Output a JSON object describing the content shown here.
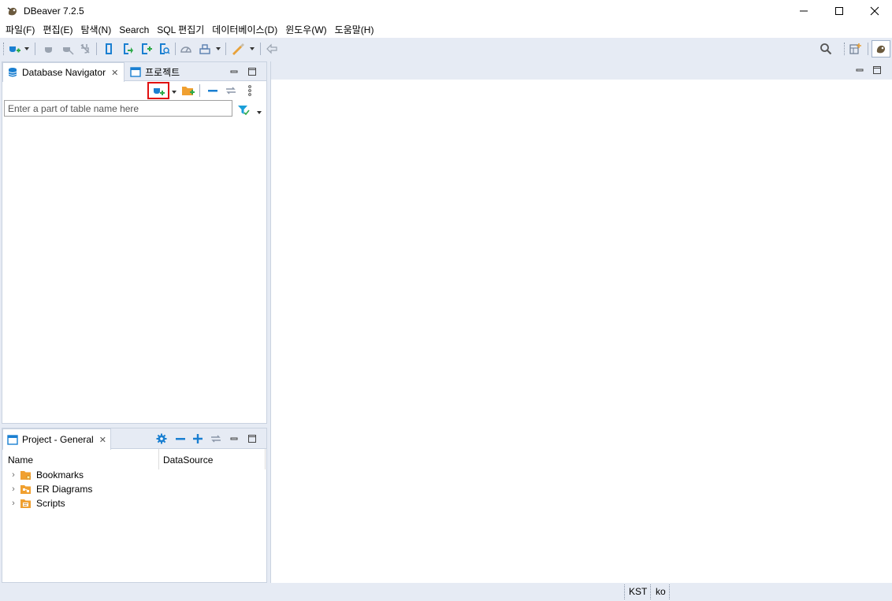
{
  "window": {
    "title": "DBeaver 7.2.5"
  },
  "menu": {
    "items": [
      "파일(F)",
      "편집(E)",
      "탐색(N)",
      "Search",
      "SQL 편집기",
      "데이터베이스(D)",
      "윈도우(W)",
      "도움말(H)"
    ]
  },
  "toolbar": {
    "icons": [
      "new-connection-icon",
      "connect-icon",
      "disconnect-icon",
      "invalidate-icon",
      "commit-mode-icon",
      "transaction-mode-icon",
      "commit-icon",
      "rollback-icon",
      "transaction-log-icon",
      "dashboard-icon",
      "sql-editor-icon",
      "tools-icon",
      "back-icon",
      "search-icon",
      "perspective-icon",
      "dbeaver-perspective-icon"
    ]
  },
  "navigator": {
    "tab_label": "Database Navigator",
    "tab2_label": "프로젝트",
    "filter_placeholder": "Enter a part of table name here"
  },
  "project": {
    "tab_label": "Project - General",
    "columns": [
      "Name",
      "DataSource"
    ],
    "items": [
      {
        "label": "Bookmarks",
        "icon": "bookmarks-folder-icon"
      },
      {
        "label": "ER Diagrams",
        "icon": "er-diagrams-folder-icon"
      },
      {
        "label": "Scripts",
        "icon": "scripts-folder-icon"
      }
    ]
  },
  "status": {
    "timezone": "KST",
    "locale": "ko"
  },
  "colors": {
    "chrome": "#e6ebf4",
    "accent_blue": "#1a7fd1",
    "highlight_red": "#e01010",
    "folder_orange": "#f0a030",
    "connect_green": "#2eaa4a"
  }
}
